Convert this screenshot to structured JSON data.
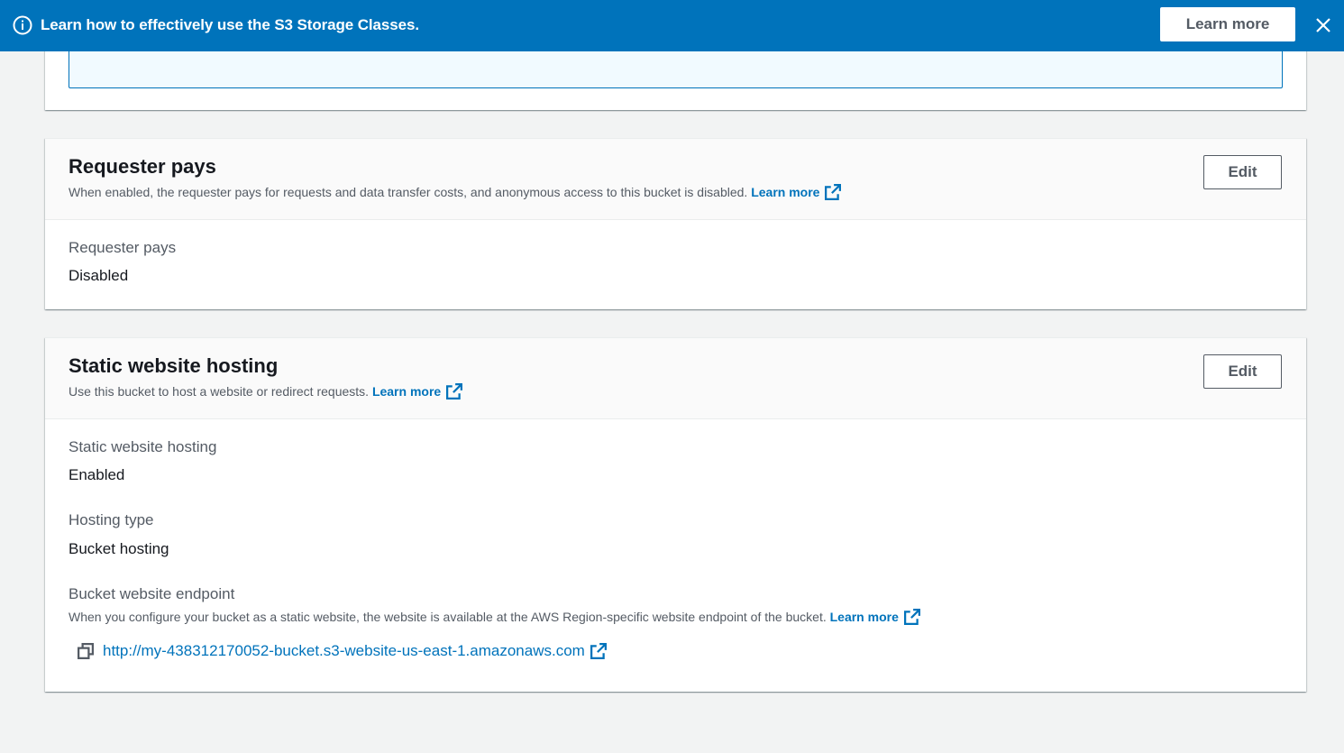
{
  "flash": {
    "message": "Learn how to effectively use the S3 Storage Classes.",
    "button_label": "Learn more",
    "icon": "info-icon",
    "close_icon": "close-icon"
  },
  "requester_pays": {
    "title": "Requester pays",
    "description": "When enabled, the requester pays for requests and data transfer costs, and anonymous access to this bucket is disabled.",
    "learn_more": "Learn more",
    "edit_label": "Edit",
    "label": "Requester pays",
    "value": "Disabled"
  },
  "static_hosting": {
    "title": "Static website hosting",
    "description": "Use this bucket to host a website or redirect requests.",
    "learn_more": "Learn more",
    "edit_label": "Edit",
    "status_label": "Static website hosting",
    "status_value": "Enabled",
    "type_label": "Hosting type",
    "type_value": "Bucket hosting",
    "endpoint_label": "Bucket website endpoint",
    "endpoint_description": "When you configure your bucket as a static website, the website is available at the AWS Region-specific website endpoint of the bucket.",
    "endpoint_learn_more": "Learn more",
    "endpoint_url": "http://my-438312170052-bucket.s3-website-us-east-1.amazonaws.com"
  },
  "colors": {
    "banner": "#0073bb",
    "link": "#0073bb",
    "text": "#16191f",
    "muted": "#545b64",
    "background": "#f2f3f3"
  }
}
